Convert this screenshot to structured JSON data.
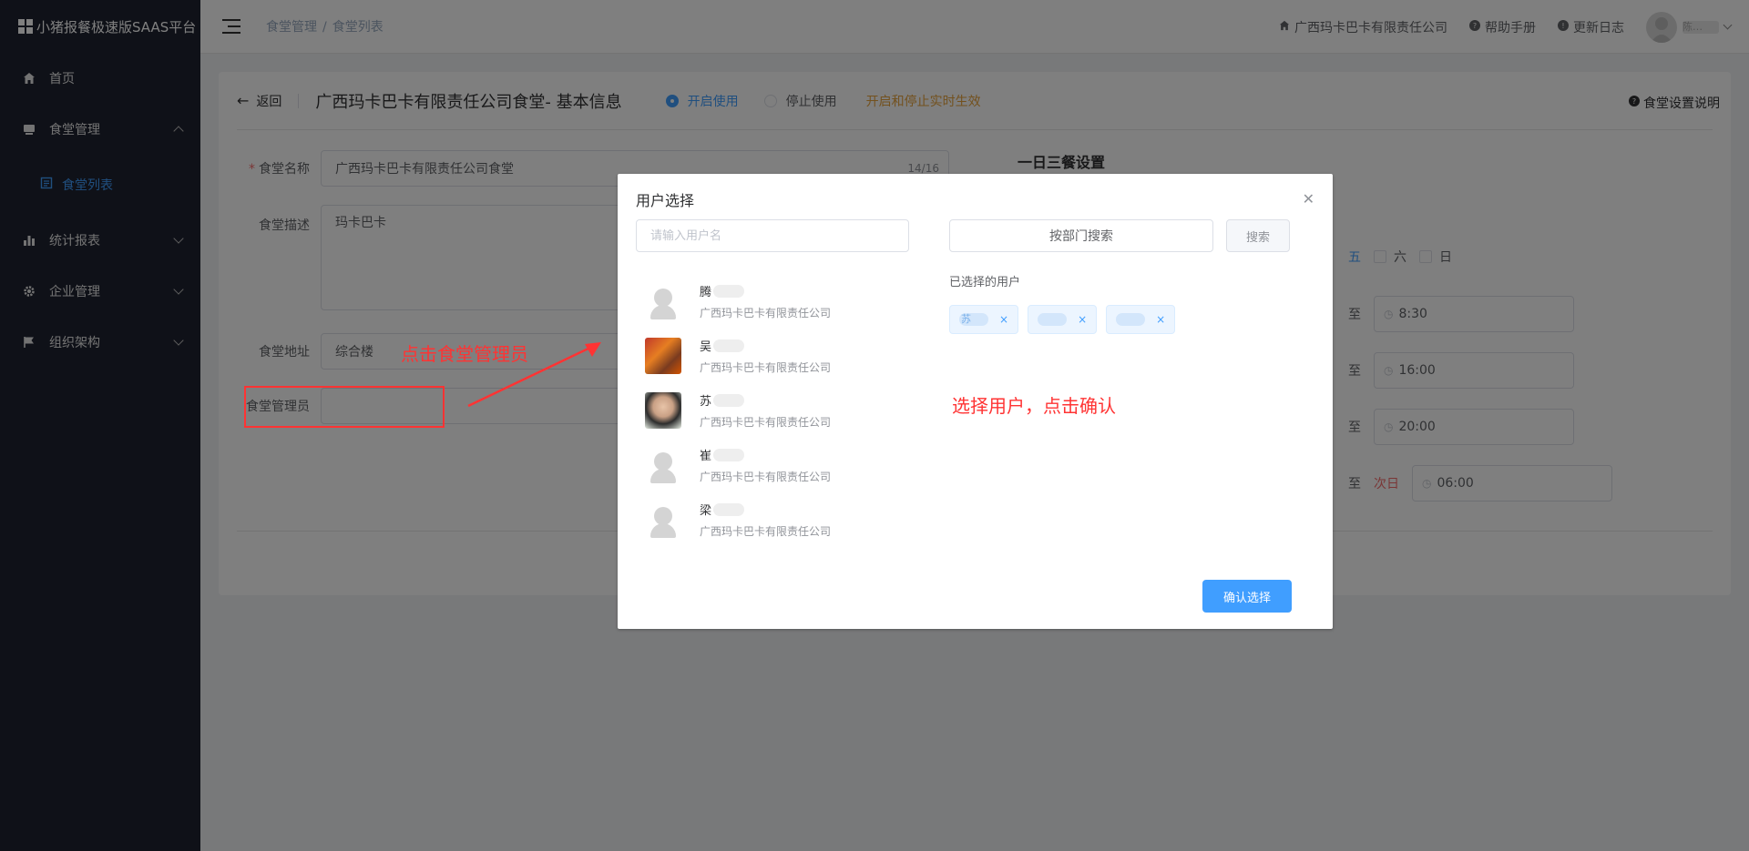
{
  "brand": {
    "title": "小猪报餐极速版SAAS平台"
  },
  "sidebar": {
    "items": [
      {
        "label": "首页",
        "icon": "home-icon"
      },
      {
        "label": "食堂管理",
        "icon": "canteen-icon",
        "expanded": true,
        "children": [
          {
            "label": "食堂列表",
            "icon": "list-icon",
            "active": true
          }
        ]
      },
      {
        "label": "统计报表",
        "icon": "chart-icon"
      },
      {
        "label": "企业管理",
        "icon": "gear-icon"
      },
      {
        "label": "组织架构",
        "icon": "flag-icon"
      }
    ]
  },
  "header": {
    "breadcrumb": [
      "食堂管理",
      "食堂列表"
    ],
    "separator": "/",
    "company": "广西玛卡巴卡有限责任公司",
    "help": "帮助手册",
    "changelog": "更新日志",
    "user_name": "陈…"
  },
  "page": {
    "back_label": "返回",
    "title": "广西玛卡巴卡有限责任公司食堂- 基本信息",
    "radio_on": "开启使用",
    "radio_off": "停止使用",
    "hint": "开启和停止实时生效",
    "help": "食堂设置说明"
  },
  "form": {
    "name_label": "食堂名称",
    "name_value": "广西玛卡巴卡有限责任公司食堂",
    "name_count": "14/16",
    "desc_label": "食堂描述",
    "desc_value": "玛卡巴卡",
    "addr_label": "食堂地址",
    "addr_value": "综合楼",
    "admin_label": "食堂管理员",
    "admin_value": ""
  },
  "meals": {
    "title": "一日三餐设置",
    "weekdays": [
      "五",
      "六",
      "日"
    ],
    "to_label": "至",
    "next_day": "次日",
    "times": [
      "8:30",
      "16:00",
      "20:00",
      "06:00"
    ]
  },
  "annotations": {
    "click_admin": "点击食堂管理员",
    "select_confirm": "选择用户，点击确认"
  },
  "dialog": {
    "title": "用户选择",
    "search_placeholder": "请输入用户名",
    "dept_search": "按部门搜索",
    "search_btn": "搜索",
    "selected_label": "已选择的用户",
    "confirm": "确认选择",
    "users": [
      {
        "name": "腾",
        "company": "广西玛卡巴卡有限责任公司",
        "avatar": "default"
      },
      {
        "name": "吴",
        "company": "广西玛卡巴卡有限责任公司",
        "avatar": "photo1"
      },
      {
        "name": "苏",
        "company": "广西玛卡巴卡有限责任公司",
        "avatar": "photo2"
      },
      {
        "name": "崔",
        "company": "广西玛卡巴卡有限责任公司",
        "avatar": "default"
      },
      {
        "name": "梁",
        "company": "广西玛卡巴卡有限责任公司",
        "avatar": "default"
      }
    ],
    "selected": [
      {
        "name": "苏"
      },
      {
        "name": ""
      },
      {
        "name": ""
      }
    ],
    "tag_close": "×"
  },
  "colors": {
    "accent": "#409eff",
    "sidebar_bg": "#1f2330",
    "warning": "#e6a23c",
    "danger": "#f56c6c",
    "annotation": "#ff3333"
  }
}
